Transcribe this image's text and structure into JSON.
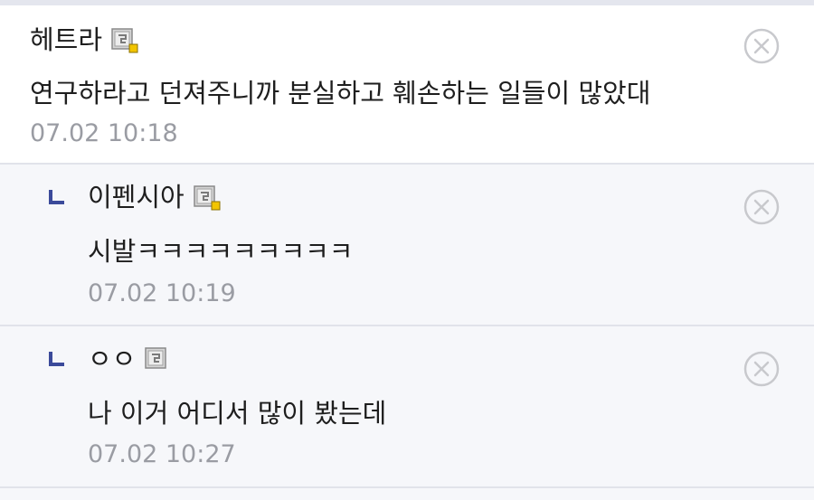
{
  "comments": [
    {
      "nickname": "헤트라",
      "text": "연구하라고 던져주니까 분실하고 훼손하는 일들이 많았대",
      "time": "07.02 10:18",
      "icon": "gallery-user-icon",
      "icon_badge": true
    },
    {
      "nickname": "이펜시아",
      "text": "시발ㅋㅋㅋㅋㅋㅋㅋㅋㅋ",
      "time": "07.02 10:19",
      "icon": "gallery-user-icon",
      "icon_badge": true,
      "is_reply": true
    },
    {
      "nickname": "ㅇㅇ",
      "text": "나 이거 어디서 많이 봤는데",
      "time": "07.02 10:27",
      "icon": "gallery-user-icon",
      "icon_badge": false,
      "is_reply": true
    }
  ],
  "colors": {
    "reply_mark": "#3b4a9a",
    "delete_icon": "#c8c9cd",
    "date_text": "#9a9ca3",
    "reply_background": "#f6f7fa",
    "divider": "#e1e3ea"
  }
}
